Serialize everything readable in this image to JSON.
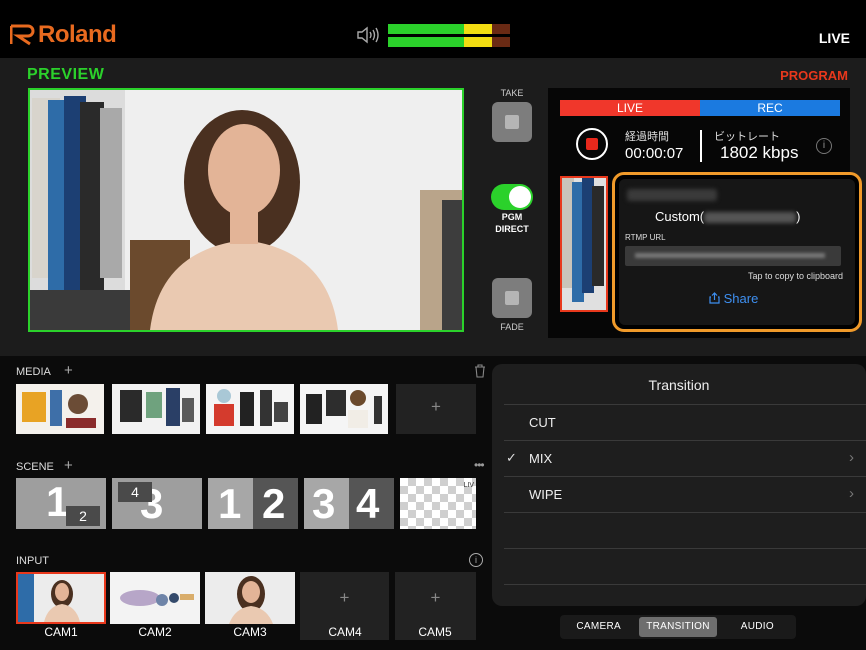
{
  "header": {
    "brand": "Roland",
    "live_label": "LIVE",
    "colors": {
      "brand": "#e86a1f",
      "meter_green": "#2bd12b",
      "meter_yellow": "#f3dd12"
    }
  },
  "preview": {
    "title": "PREVIEW"
  },
  "program": {
    "title": "PROGRAM",
    "stream_tabs": {
      "live": "LIVE",
      "rec": "REC"
    },
    "elapsed_label": "経過時間",
    "elapsed_value": "00:00:07",
    "bitrate_label": "ビットレート",
    "bitrate_value": "1802  kbps"
  },
  "controls": {
    "take_label": "TAKE",
    "pgm_direct_label_1": "PGM",
    "pgm_direct_label_2": "DIRECT",
    "pgm_direct_on": true,
    "fade_label": "FADE"
  },
  "popover": {
    "custom_prefix": "Custom(",
    "custom_suffix": ")",
    "rtmp_label": "RTMP URL",
    "copy_hint": "Tap to copy to clipboard",
    "share_label": "Share"
  },
  "media": {
    "label": "MEDIA",
    "add": "+"
  },
  "scene": {
    "label": "SCENE",
    "add": "+",
    "tiles": [
      {
        "big": "1",
        "small": "2"
      },
      {
        "big": "3",
        "small": "4"
      },
      {
        "left": "1",
        "right": "2"
      },
      {
        "left": "3",
        "right": "4"
      },
      {
        "corner": "LIV"
      }
    ]
  },
  "input": {
    "label": "INPUT",
    "cams": [
      "CAM1",
      "CAM2",
      "CAM3",
      "CAM4",
      "CAM5"
    ],
    "add": "+"
  },
  "transition": {
    "title": "Transition",
    "items": [
      {
        "name": "CUT",
        "selected": false,
        "chevron": ""
      },
      {
        "name": "MIX",
        "selected": true,
        "chevron": "›"
      },
      {
        "name": "WIPE",
        "selected": false,
        "chevron": "›"
      }
    ],
    "check_mark": "✓"
  },
  "bottom_tabs": {
    "camera": "CAMERA",
    "transition": "TRANSITION",
    "audio": "AUDIO",
    "active": "TRANSITION"
  }
}
